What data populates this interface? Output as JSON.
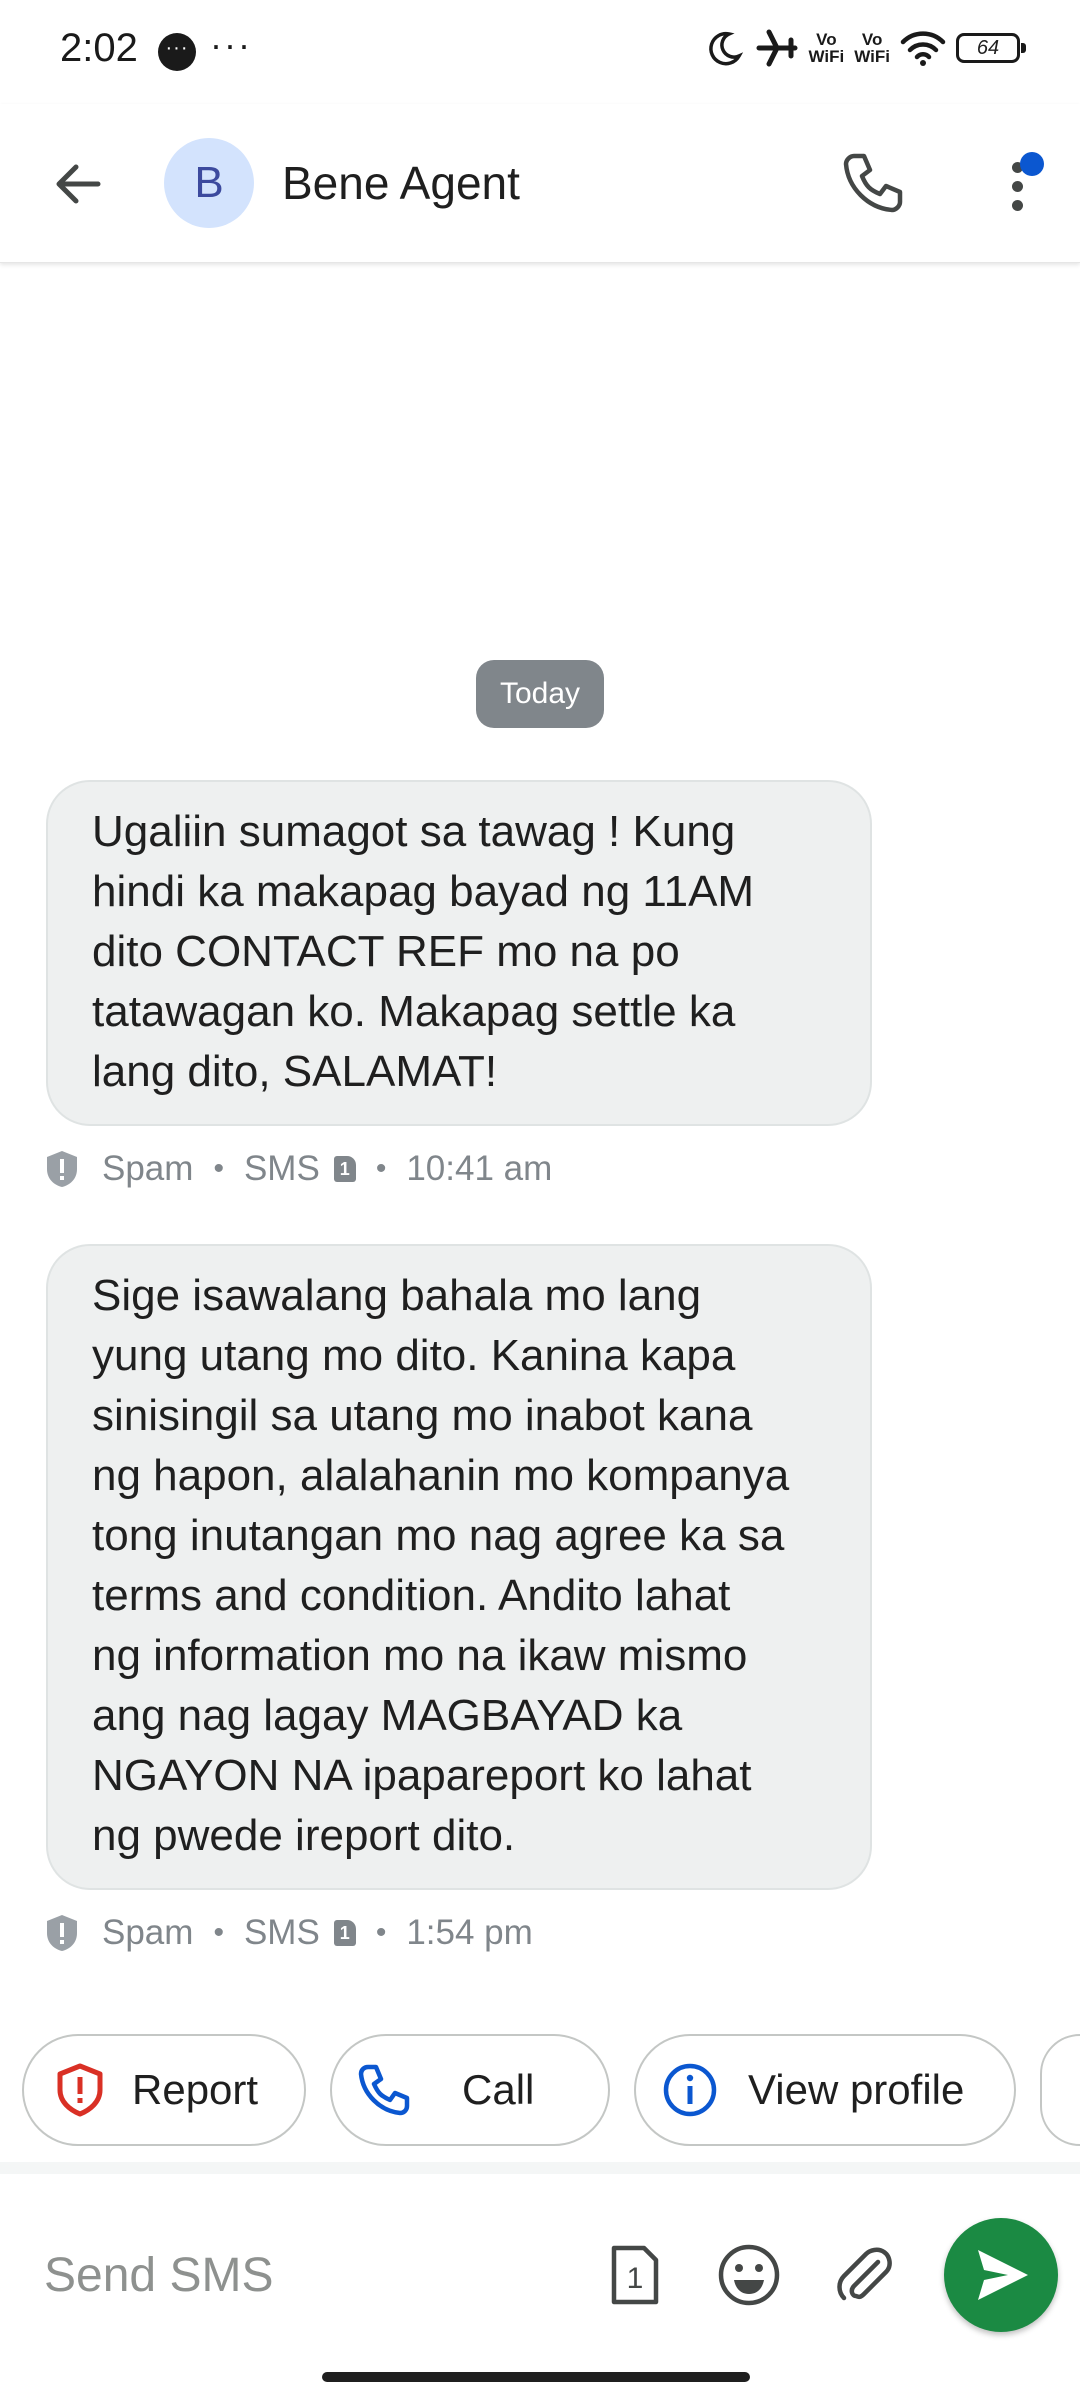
{
  "status_bar": {
    "time": "2:02",
    "chat_bubble": "···",
    "more": "···",
    "vowifi_1": "Vo\nWiFi",
    "vowifi_2": "Vo\nWiFi",
    "battery": "64",
    "icons": [
      "moon-icon",
      "airplane-icon",
      "wifi-icon",
      "battery-icon"
    ]
  },
  "header": {
    "avatar_letter": "B",
    "contact_name": "Bene Agent",
    "icons": [
      "back-arrow-icon",
      "phone-icon",
      "more-vert-icon"
    ],
    "accent": "#0b57d0"
  },
  "conversation": {
    "date_label": "Today",
    "messages": [
      {
        "text": "Ugaliin sumagot sa tawag ! Kung\nhindi ka makapag bayad ng 11AM\ndito CONTACT REF mo na po\ntatawagan ko. Makapag settle ka\nlang dito, SALAMAT!",
        "label": "Spam",
        "channel": "SMS",
        "sim": "1",
        "time": "10:41 am"
      },
      {
        "text": "Sige isawalang bahala mo lang\nyung utang mo dito. Kanina kapa\nsinisingil sa utang mo inabot kana\nng hapon, alalahanin mo kompanya\ntong inutangan mo nag agree ka sa\nterms and condition. Andito lahat\nng information mo na ikaw mismo\nang nag lagay MAGBAYAD ka\nNGAYON NA ipapareport ko lahat\nng pwede ireport dito.",
        "label": "Spam",
        "channel": "SMS",
        "sim": "1",
        "time": "1:54 pm"
      }
    ]
  },
  "suggestions": {
    "report": "Report",
    "call": "Call",
    "view_profile": "View profile"
  },
  "compose": {
    "placeholder": "Send SMS",
    "sim": "1",
    "send_color": "#1b8a43"
  }
}
